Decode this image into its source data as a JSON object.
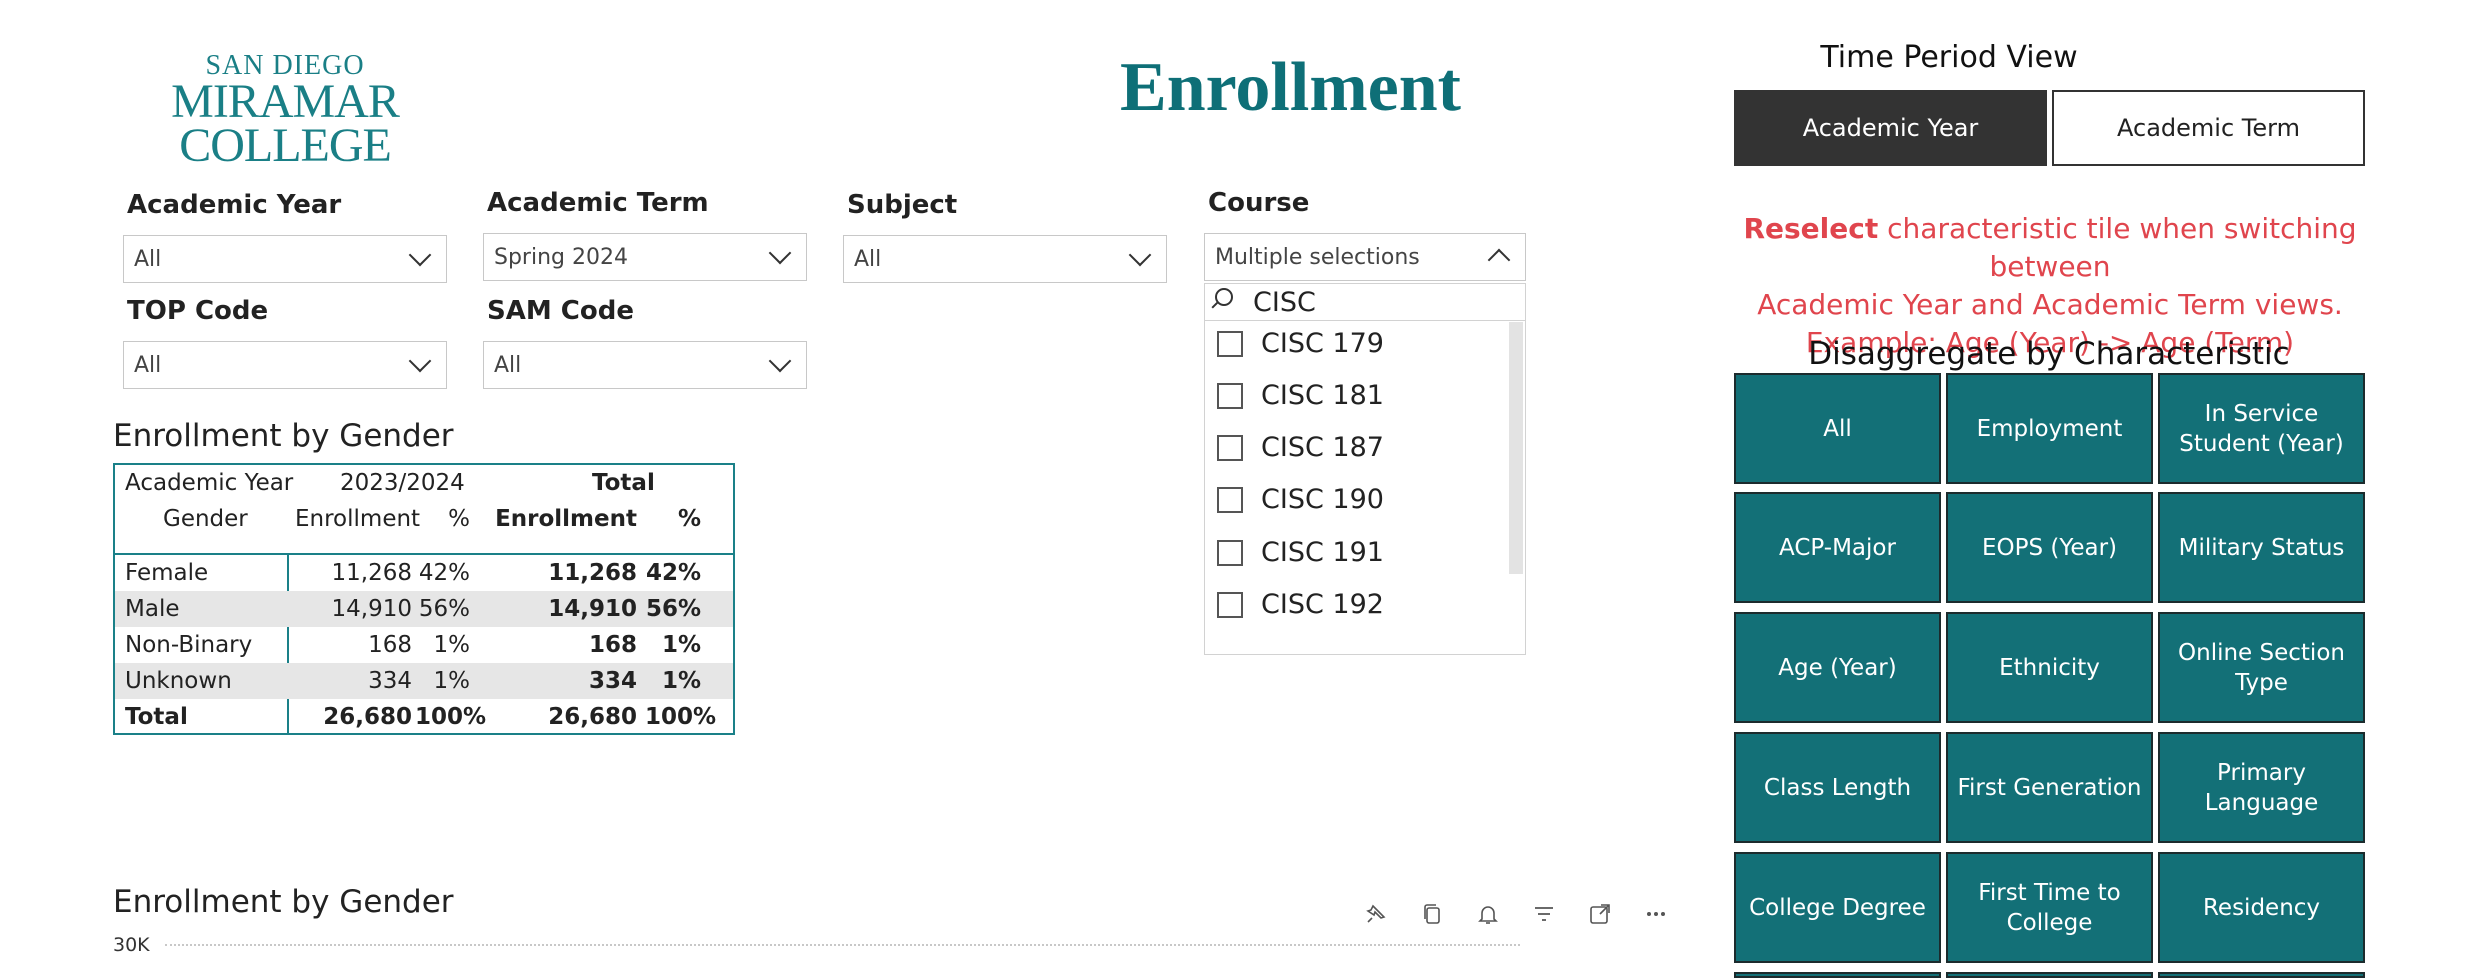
{
  "logo": {
    "line1": "SAN DIEGO",
    "line2": "MIRAMAR",
    "line3": "COLLEGE"
  },
  "page_title": "Enrollment",
  "slicers": {
    "academic_year": {
      "label": "Academic Year",
      "value": "All"
    },
    "academic_term": {
      "label": "Academic Term",
      "value": "Spring 2024"
    },
    "subject": {
      "label": "Subject",
      "value": "All"
    },
    "course": {
      "label": "Course",
      "value": "Multiple selections",
      "search_text": "CISC",
      "options": [
        "CISC 179",
        "CISC 181",
        "CISC 187",
        "CISC 190",
        "CISC 191",
        "CISC 192"
      ]
    },
    "top_code": {
      "label": "TOP Code",
      "value": "All"
    },
    "sam_code": {
      "label": "SAM Code",
      "value": "All"
    }
  },
  "table": {
    "title": "Enrollment by Gender",
    "hdr_academic_year": "Academic Year",
    "hdr_year_value": "2023/2024",
    "hdr_total": "Total",
    "hdr_gender": "Gender",
    "hdr_enrollment": "Enrollment",
    "hdr_pct": "%",
    "hdr_total_enrollment": "Enrollment",
    "hdr_total_pct": "%",
    "rows": [
      {
        "gender": "Female",
        "enrollment": "11,268",
        "pct": "42%",
        "total_enrollment": "11,268",
        "total_pct": "42%"
      },
      {
        "gender": "Male",
        "enrollment": "14,910",
        "pct": "56%",
        "total_enrollment": "14,910",
        "total_pct": "56%"
      },
      {
        "gender": "Non-Binary",
        "enrollment": "168",
        "pct": "1%",
        "total_enrollment": "168",
        "total_pct": "1%"
      },
      {
        "gender": "Unknown",
        "enrollment": "334",
        "pct": "1%",
        "total_enrollment": "334",
        "total_pct": "1%"
      }
    ],
    "total_row": {
      "label": "Total",
      "enrollment": "26,680",
      "pct": "100%",
      "total_enrollment": "26,680",
      "total_pct": "100%"
    }
  },
  "chart": {
    "title": "Enrollment by Gender",
    "y_tick_top": "30K"
  },
  "visual_icons": [
    "pin-icon",
    "copy-icon",
    "bell-icon",
    "filter-icon",
    "focus-mode-icon",
    "more-options-icon"
  ],
  "time_period": {
    "title": "Time Period View",
    "buttons": [
      "Academic Year",
      "Academic Term"
    ],
    "selected": "Academic Year"
  },
  "notice": {
    "bold": "Reselect",
    "line1_rest": " characteristic tile when switching between",
    "line2": "Academic Year and Academic Term views.",
    "line3": "Example: Age (Year) -> Age (Term)"
  },
  "disaggregate": {
    "title": "Disaggregate by Characteristic",
    "tiles": [
      "All",
      "Employment",
      "In Service Student (Year)",
      "ACP-Major",
      "EOPS (Year)",
      "Military Status",
      "Age (Year)",
      "Ethnicity",
      "Online Section Type",
      "Class Length",
      "First Generation",
      "Primary Language",
      "College Degree",
      "First Time to College",
      "Residency"
    ]
  },
  "colors": {
    "teal": "#137077",
    "title_teal": "#0e6f77",
    "alert_red": "#e0454d",
    "dark_button": "#333333"
  }
}
